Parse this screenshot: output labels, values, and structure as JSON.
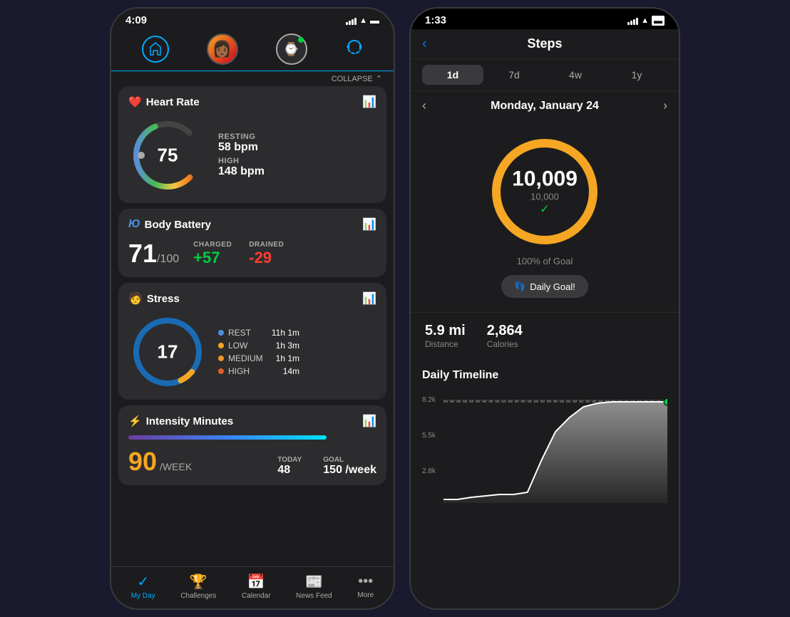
{
  "leftPhone": {
    "statusBar": {
      "time": "4:09",
      "signal": "●●●",
      "wifi": "wifi",
      "battery": "battery"
    },
    "nav": {
      "avatarEmoji": "👩🏾",
      "watchIcon": "⌚",
      "syncIcon": "🔄"
    },
    "collapseLabel": "COLLAPSE",
    "cards": {
      "heartRate": {
        "title": "Heart Rate",
        "icon": "❤️",
        "currentValue": "75",
        "restingLabel": "RESTING",
        "restingValue": "58 bpm",
        "highLabel": "HIGH",
        "highValue": "148 bpm"
      },
      "bodyBattery": {
        "title": "Body Battery",
        "icon": "⚡",
        "value": "71",
        "sub": "/100",
        "chargedLabel": "CHARGED",
        "chargedValue": "+57",
        "drainedLabel": "DRAINED",
        "drainedValue": "-29"
      },
      "stress": {
        "title": "Stress",
        "icon": "🧑",
        "value": "17",
        "legend": [
          {
            "label": "REST",
            "color": "#4a90d9",
            "time": "11h 1m"
          },
          {
            "label": "LOW",
            "color": "#f5a623",
            "time": "1h 3m"
          },
          {
            "label": "MEDIUM",
            "color": "#f0932b",
            "time": "1h 1m"
          },
          {
            "label": "HIGH",
            "color": "#e05c2a",
            "time": "14m"
          }
        ]
      },
      "intensity": {
        "title": "Intensity Minutes",
        "icon": "🔥",
        "value": "90",
        "perLabel": "/WEEK",
        "todayLabel": "TODAY",
        "todayValue": "48",
        "goalLabel": "GOAL",
        "goalValue": "150 /week"
      }
    },
    "bottomNav": [
      {
        "label": "My Day",
        "icon": "✓",
        "active": true
      },
      {
        "label": "Challenges",
        "icon": "🏆",
        "active": false
      },
      {
        "label": "Calendar",
        "icon": "📅",
        "active": false
      },
      {
        "label": "News Feed",
        "icon": "📰",
        "active": false
      },
      {
        "label": "More",
        "icon": "•••",
        "active": false
      }
    ]
  },
  "rightPhone": {
    "statusBar": {
      "time": "1:33",
      "signal": "signal",
      "wifi": "wifi",
      "battery": "battery"
    },
    "title": "Steps",
    "timeTabs": [
      {
        "label": "1d",
        "active": true
      },
      {
        "label": "7d",
        "active": false
      },
      {
        "label": "4w",
        "active": false
      },
      {
        "label": "1y",
        "active": false
      }
    ],
    "dateLabel": "Monday, January 24",
    "steps": {
      "value": "10,009",
      "goal": "10,000",
      "checkmark": "✓",
      "percentLabel": "100% of Goal",
      "goalBtnLabel": "Daily Goal!",
      "goalBtnIcon": "👣"
    },
    "statsRow": {
      "distance": {
        "value": "5.9 mi",
        "label": "Distance"
      },
      "calories": {
        "value": "2,864",
        "label": "Calories"
      }
    },
    "dailyTimeline": {
      "title": "Daily Timeline",
      "yLabels": [
        "8.2k",
        "5.5k",
        "2.8k"
      ]
    }
  }
}
